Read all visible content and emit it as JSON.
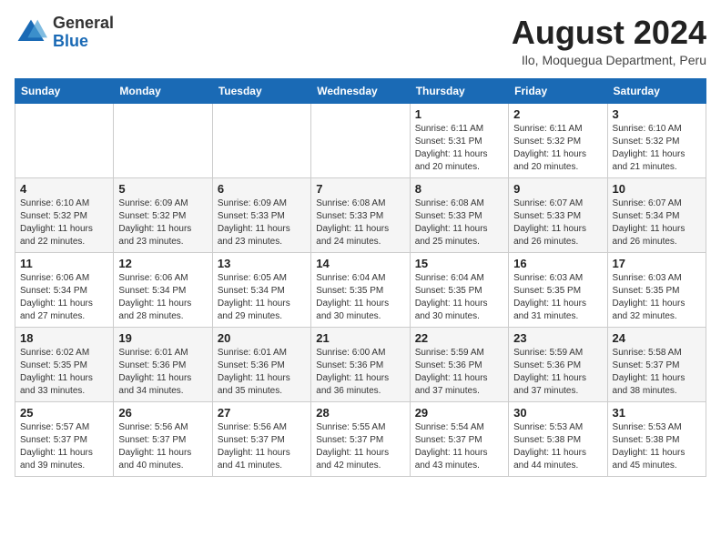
{
  "header": {
    "logo_general": "General",
    "logo_blue": "Blue",
    "title": "August 2024",
    "subtitle": "Ilo, Moquegua Department, Peru"
  },
  "days_of_week": [
    "Sunday",
    "Monday",
    "Tuesday",
    "Wednesday",
    "Thursday",
    "Friday",
    "Saturday"
  ],
  "weeks": [
    [
      {
        "day": "",
        "info": ""
      },
      {
        "day": "",
        "info": ""
      },
      {
        "day": "",
        "info": ""
      },
      {
        "day": "",
        "info": ""
      },
      {
        "day": "1",
        "info": "Sunrise: 6:11 AM\nSunset: 5:31 PM\nDaylight: 11 hours and 20 minutes."
      },
      {
        "day": "2",
        "info": "Sunrise: 6:11 AM\nSunset: 5:32 PM\nDaylight: 11 hours and 20 minutes."
      },
      {
        "day": "3",
        "info": "Sunrise: 6:10 AM\nSunset: 5:32 PM\nDaylight: 11 hours and 21 minutes."
      }
    ],
    [
      {
        "day": "4",
        "info": "Sunrise: 6:10 AM\nSunset: 5:32 PM\nDaylight: 11 hours and 22 minutes."
      },
      {
        "day": "5",
        "info": "Sunrise: 6:09 AM\nSunset: 5:32 PM\nDaylight: 11 hours and 23 minutes."
      },
      {
        "day": "6",
        "info": "Sunrise: 6:09 AM\nSunset: 5:33 PM\nDaylight: 11 hours and 23 minutes."
      },
      {
        "day": "7",
        "info": "Sunrise: 6:08 AM\nSunset: 5:33 PM\nDaylight: 11 hours and 24 minutes."
      },
      {
        "day": "8",
        "info": "Sunrise: 6:08 AM\nSunset: 5:33 PM\nDaylight: 11 hours and 25 minutes."
      },
      {
        "day": "9",
        "info": "Sunrise: 6:07 AM\nSunset: 5:33 PM\nDaylight: 11 hours and 26 minutes."
      },
      {
        "day": "10",
        "info": "Sunrise: 6:07 AM\nSunset: 5:34 PM\nDaylight: 11 hours and 26 minutes."
      }
    ],
    [
      {
        "day": "11",
        "info": "Sunrise: 6:06 AM\nSunset: 5:34 PM\nDaylight: 11 hours and 27 minutes."
      },
      {
        "day": "12",
        "info": "Sunrise: 6:06 AM\nSunset: 5:34 PM\nDaylight: 11 hours and 28 minutes."
      },
      {
        "day": "13",
        "info": "Sunrise: 6:05 AM\nSunset: 5:34 PM\nDaylight: 11 hours and 29 minutes."
      },
      {
        "day": "14",
        "info": "Sunrise: 6:04 AM\nSunset: 5:35 PM\nDaylight: 11 hours and 30 minutes."
      },
      {
        "day": "15",
        "info": "Sunrise: 6:04 AM\nSunset: 5:35 PM\nDaylight: 11 hours and 30 minutes."
      },
      {
        "day": "16",
        "info": "Sunrise: 6:03 AM\nSunset: 5:35 PM\nDaylight: 11 hours and 31 minutes."
      },
      {
        "day": "17",
        "info": "Sunrise: 6:03 AM\nSunset: 5:35 PM\nDaylight: 11 hours and 32 minutes."
      }
    ],
    [
      {
        "day": "18",
        "info": "Sunrise: 6:02 AM\nSunset: 5:35 PM\nDaylight: 11 hours and 33 minutes."
      },
      {
        "day": "19",
        "info": "Sunrise: 6:01 AM\nSunset: 5:36 PM\nDaylight: 11 hours and 34 minutes."
      },
      {
        "day": "20",
        "info": "Sunrise: 6:01 AM\nSunset: 5:36 PM\nDaylight: 11 hours and 35 minutes."
      },
      {
        "day": "21",
        "info": "Sunrise: 6:00 AM\nSunset: 5:36 PM\nDaylight: 11 hours and 36 minutes."
      },
      {
        "day": "22",
        "info": "Sunrise: 5:59 AM\nSunset: 5:36 PM\nDaylight: 11 hours and 37 minutes."
      },
      {
        "day": "23",
        "info": "Sunrise: 5:59 AM\nSunset: 5:36 PM\nDaylight: 11 hours and 37 minutes."
      },
      {
        "day": "24",
        "info": "Sunrise: 5:58 AM\nSunset: 5:37 PM\nDaylight: 11 hours and 38 minutes."
      }
    ],
    [
      {
        "day": "25",
        "info": "Sunrise: 5:57 AM\nSunset: 5:37 PM\nDaylight: 11 hours and 39 minutes."
      },
      {
        "day": "26",
        "info": "Sunrise: 5:56 AM\nSunset: 5:37 PM\nDaylight: 11 hours and 40 minutes."
      },
      {
        "day": "27",
        "info": "Sunrise: 5:56 AM\nSunset: 5:37 PM\nDaylight: 11 hours and 41 minutes."
      },
      {
        "day": "28",
        "info": "Sunrise: 5:55 AM\nSunset: 5:37 PM\nDaylight: 11 hours and 42 minutes."
      },
      {
        "day": "29",
        "info": "Sunrise: 5:54 AM\nSunset: 5:37 PM\nDaylight: 11 hours and 43 minutes."
      },
      {
        "day": "30",
        "info": "Sunrise: 5:53 AM\nSunset: 5:38 PM\nDaylight: 11 hours and 44 minutes."
      },
      {
        "day": "31",
        "info": "Sunrise: 5:53 AM\nSunset: 5:38 PM\nDaylight: 11 hours and 45 minutes."
      }
    ]
  ]
}
